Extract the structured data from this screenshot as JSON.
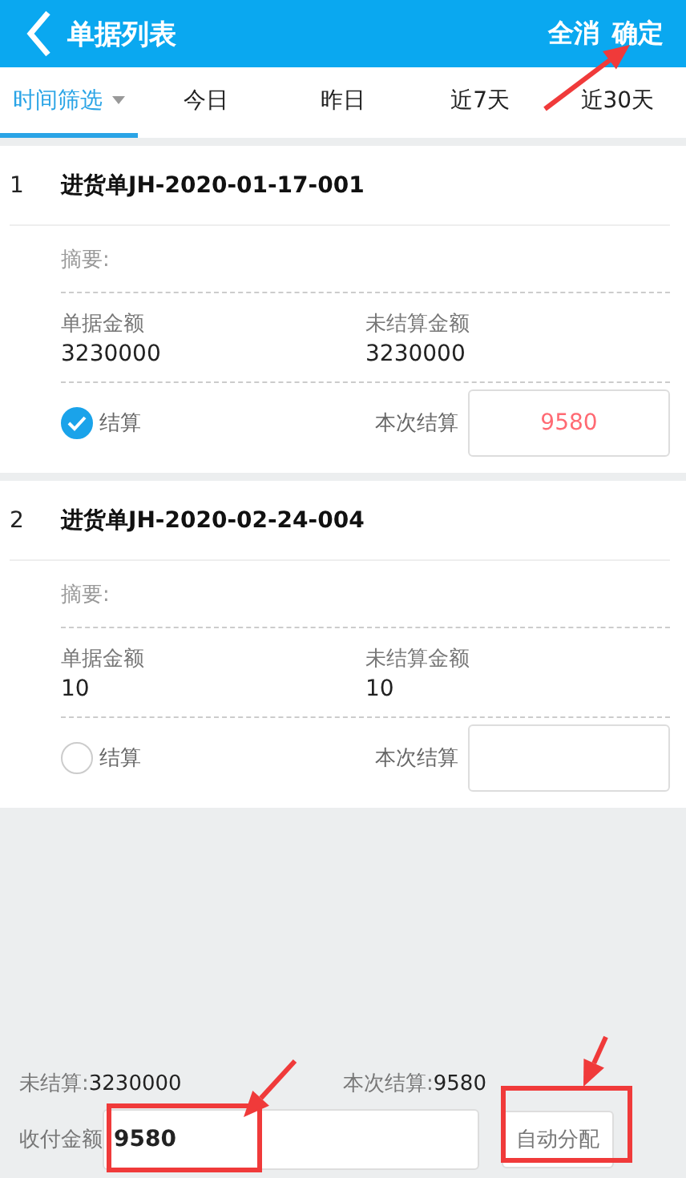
{
  "header": {
    "title": "单据列表",
    "actions": [
      "全消",
      "确定"
    ]
  },
  "tabs": [
    {
      "label": "时间筛选",
      "selected": true,
      "kind": "dropdown"
    },
    {
      "label": "今日",
      "selected": false,
      "kind": "plain"
    },
    {
      "label": "昨日",
      "selected": false,
      "kind": "plain"
    },
    {
      "label": "近7天",
      "selected": false,
      "kind": "plain"
    },
    {
      "label": "近30天",
      "selected": false,
      "kind": "plain"
    }
  ],
  "bills": [
    {
      "index": "1",
      "title": "进货单JH-2020-01-17-001",
      "summary_label": "摘要:",
      "amount_label": "单据金额",
      "amount": "3230000",
      "unsettled_label": "未结算金额",
      "unsettled": "3230000",
      "settle_label": "结算",
      "checked": true,
      "this_label": "本次结算",
      "this_value": "9580"
    },
    {
      "index": "2",
      "title": "进货单JH-2020-02-24-004",
      "summary_label": "摘要:",
      "amount_label": "单据金额",
      "amount": "10",
      "unsettled_label": "未结算金额",
      "unsettled": "10",
      "settle_label": "结算",
      "checked": false,
      "this_label": "本次结算"
    }
  ],
  "footer": {
    "unsettled_label": "未结算:",
    "unsettled": "3230000",
    "this_label": "本次结算:",
    "this_value": "9580",
    "pay_label": "收付金额",
    "pay_value": "9580",
    "auto_button": "自动分配"
  }
}
